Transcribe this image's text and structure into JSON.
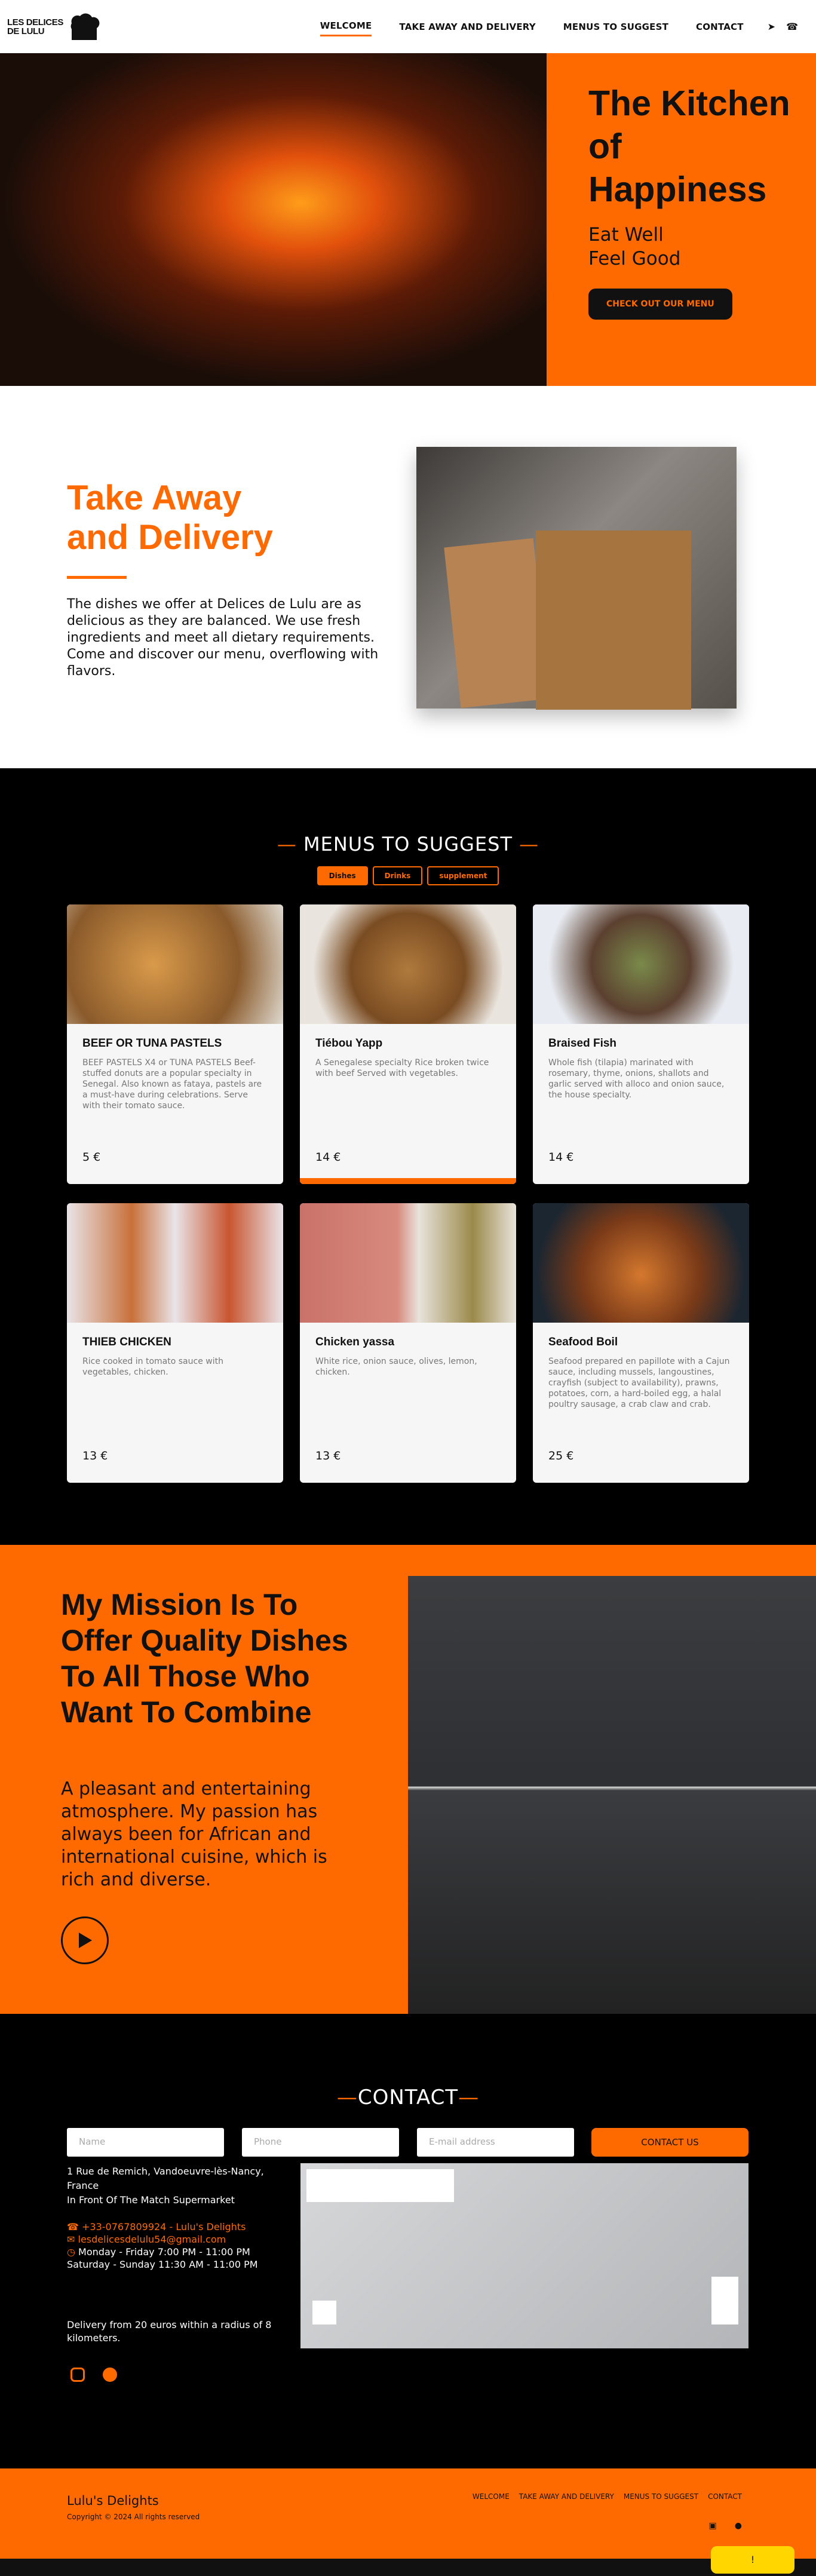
{
  "brand": {
    "logo_line1": "LES DELICES",
    "logo_line2": "DE LULU"
  },
  "nav": {
    "links": [
      "WELCOME",
      "TAKE AWAY AND DELIVERY",
      "MENUS TO SUGGEST",
      "CONTACT"
    ],
    "icons": [
      "location-arrow-icon",
      "phone-icon"
    ]
  },
  "hero": {
    "title": "The Kitchen of Happiness",
    "subtitle_line1": "Eat Well",
    "subtitle_line2": "Feel Good",
    "button": "CHECK OUT OUR MENU"
  },
  "takeaway": {
    "title_line1": "Take Away",
    "title_line2": "and Delivery",
    "text": "The dishes we offer at Delices de Lulu are as delicious as they are balanced. We use fresh ingredients and meet all dietary requirements. Come and discover our menu, overflowing with flavors."
  },
  "menus": {
    "heading": "MENUS TO SUGGEST",
    "tabs": [
      "Dishes",
      "Drinks",
      "supplement"
    ],
    "cards": [
      {
        "title": "BEEF OR TUNA PASTELS",
        "desc": "BEEF PASTELS X4 or TUNA PASTELS Beef-stuffed donuts are a popular specialty in Senegal. Also known as fataya, pastels are a must-have during celebrations. Serve with their tomato sauce.",
        "price": "5 €"
      },
      {
        "title": "Tiébou Yapp",
        "desc": "A Senegalese specialty Rice broken twice with beef Served with vegetables.",
        "price": "14 €"
      },
      {
        "title": "Braised Fish",
        "desc": "Whole fish (tilapia) marinated with rosemary, thyme, onions, shallots and garlic served with alloco and onion sauce, the house specialty.",
        "price": "14 €"
      },
      {
        "title": "THIEB CHICKEN",
        "desc": "Rice cooked in tomato sauce with vegetables, chicken.",
        "price": "13 €"
      },
      {
        "title": "Chicken yassa",
        "desc": "White rice, onion sauce, olives, lemon, chicken.",
        "price": "13 €"
      },
      {
        "title": "Seafood Boil",
        "desc": "Seafood prepared en papillote with a Cajun sauce, including mussels, langoustines, crayfish (subject to availability), prawns, potatoes, corn, a hard-boiled egg, a halal poultry sausage, a crab claw and crab.",
        "price": "25 €"
      }
    ]
  },
  "mission": {
    "title": "My Mission Is To Offer Quality Dishes To All Those Who Want To Combine",
    "text": "A pleasant and entertaining atmosphere. My passion has always been for African and international cuisine, which is rich and diverse."
  },
  "contact": {
    "heading": "CONTACT",
    "name_placeholder": "Name",
    "phone_placeholder": "Phone",
    "email_placeholder": "E-mail address",
    "button": "CONTACT US",
    "address_line1": "1 Rue de Remich, Vandoeuvre-lès-Nancy, France",
    "address_line2": "In Front Of The Match Supermarket",
    "phone": "+33-0767809924",
    "phone_name": "Lulu's Delights",
    "email": "lesdelicesdelulu54@gmail.com",
    "hours_week": "Monday - Friday 7:00 PM - 11:00 PM",
    "hours_weekend": "Saturday - Sunday 11:30 AM - 11:00 PM",
    "delivery": "Delivery from 20 euros within a radius of 8 kilometers."
  },
  "footer": {
    "name": "Lulu's Delights",
    "copyright": "Copyright © 2024 All rights reserved",
    "links": [
      "WELCOME",
      "TAKE AWAY AND DELIVERY",
      "MENUS TO SUGGEST",
      "CONTACT"
    ]
  },
  "colors": {
    "accent": "#ff6a00",
    "dark": "#000000"
  }
}
